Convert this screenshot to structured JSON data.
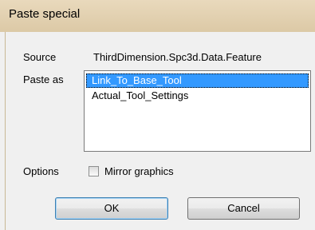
{
  "window": {
    "title": "Paste special"
  },
  "form": {
    "source_label": "Source",
    "source_value": "ThirdDimension.Spc3d.Data.Feature",
    "paste_as_label": "Paste as",
    "paste_as_options": [
      {
        "label": "Link_To_Base_Tool",
        "selected": true
      },
      {
        "label": "Actual_Tool_Settings",
        "selected": false
      }
    ],
    "options_label": "Options",
    "mirror_graphics_label": "Mirror graphics",
    "mirror_graphics_checked": false
  },
  "buttons": {
    "ok_label": "OK",
    "cancel_label": "Cancel"
  }
}
